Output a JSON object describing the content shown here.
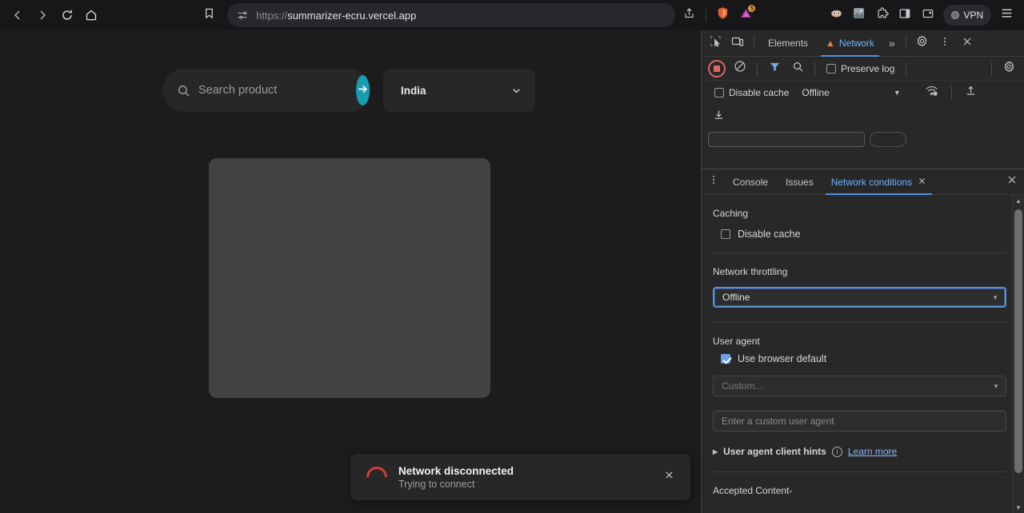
{
  "browser": {
    "back_icon": "back-arrow-icon",
    "forward_icon": "forward-arrow-icon",
    "reload_icon": "reload-icon",
    "home_icon": "home-icon",
    "bookmark_icon": "bookmark-icon",
    "address": {
      "scheme": "https://",
      "host": "summarizer-ecru.vercel.app",
      "site_settings_icon": "site-settings-icon"
    },
    "actions": {
      "share_icon": "share-icon",
      "brave_shields_icon": "brave-shields-icon",
      "brave_rewards_icon": "brave-rewards-icon",
      "rewards_badge": "5",
      "leo_ai_icon": "leo-ai-icon",
      "wallet_icon": "brave-wallet-icon",
      "extensions_icon": "extensions-puzzle-icon",
      "sidebar_icon": "sidebar-toggle-icon",
      "bookmarks_icon": "bookmarks-bar-icon",
      "vpn_label": "VPN",
      "menu_icon": "hamburger-menu-icon"
    }
  },
  "page": {
    "search": {
      "placeholder": "Search product",
      "value": "",
      "search_icon": "magnifier-icon",
      "submit_icon": "arrow-right-icon"
    },
    "country": {
      "selected": "India",
      "caret_icon": "chevron-down-icon"
    },
    "toast": {
      "title": "Network disconnected",
      "subtitle": "Trying to connect",
      "spinner_icon": "loading-spinner-icon",
      "close_icon": "close-x-icon"
    }
  },
  "devtools": {
    "topbar": {
      "inspect_icon": "inspect-element-icon",
      "device_toolbar_icon": "device-toolbar-icon",
      "tabs": [
        {
          "label": "Elements",
          "active": false,
          "warning": false
        },
        {
          "label": "Network",
          "active": true,
          "warning": true
        }
      ],
      "more_tabs_icon": "chevrons-right-icon",
      "settings_icon": "gear-icon",
      "kebab_icon": "vertical-dots-icon",
      "close_icon": "close-x-icon"
    },
    "network_toolbar": {
      "record_icon": "record-stop-icon",
      "clear_icon": "clear-network-log-icon",
      "filter_icon": "filter-funnel-icon",
      "search_icon": "magnifier-icon",
      "preserve_log_label": "Preserve log",
      "preserve_log_checked": false,
      "settings_icon": "gear-icon",
      "disable_cache_label": "Disable cache",
      "disable_cache_checked": false,
      "throttling_value": "Offline",
      "throttling_caret_icon": "caret-down-icon",
      "wifi_settings_icon": "network-conditions-wifi-icon",
      "import_har_icon": "import-har-icon",
      "export_har_icon": "export-har-icon"
    },
    "drawer": {
      "kebab_icon": "vertical-dots-icon",
      "tabs": [
        {
          "label": "Console",
          "active": false,
          "closable": false
        },
        {
          "label": "Issues",
          "active": false,
          "closable": false
        },
        {
          "label": "Network conditions",
          "active": true,
          "closable": true
        }
      ],
      "close_icon": "close-x-icon",
      "panel": {
        "caching_title": "Caching",
        "disable_cache_label": "Disable cache",
        "disable_cache_checked": false,
        "throttling_title": "Network throttling",
        "throttling_value": "Offline",
        "user_agent_title": "User agent",
        "use_browser_default_label": "Use browser default",
        "use_browser_default_checked": true,
        "custom_ua_select_value": "Custom...",
        "custom_ua_input_placeholder": "Enter a custom user agent",
        "client_hints_label": "User agent client hints",
        "client_hints_info_icon": "info-circle-icon",
        "learn_more_label": "Learn more",
        "accepted_content_title": "Accepted Content-"
      },
      "scrollbar": {
        "up_icon": "scroll-up-arrow-icon",
        "down_icon": "scroll-down-arrow-icon"
      }
    }
  }
}
